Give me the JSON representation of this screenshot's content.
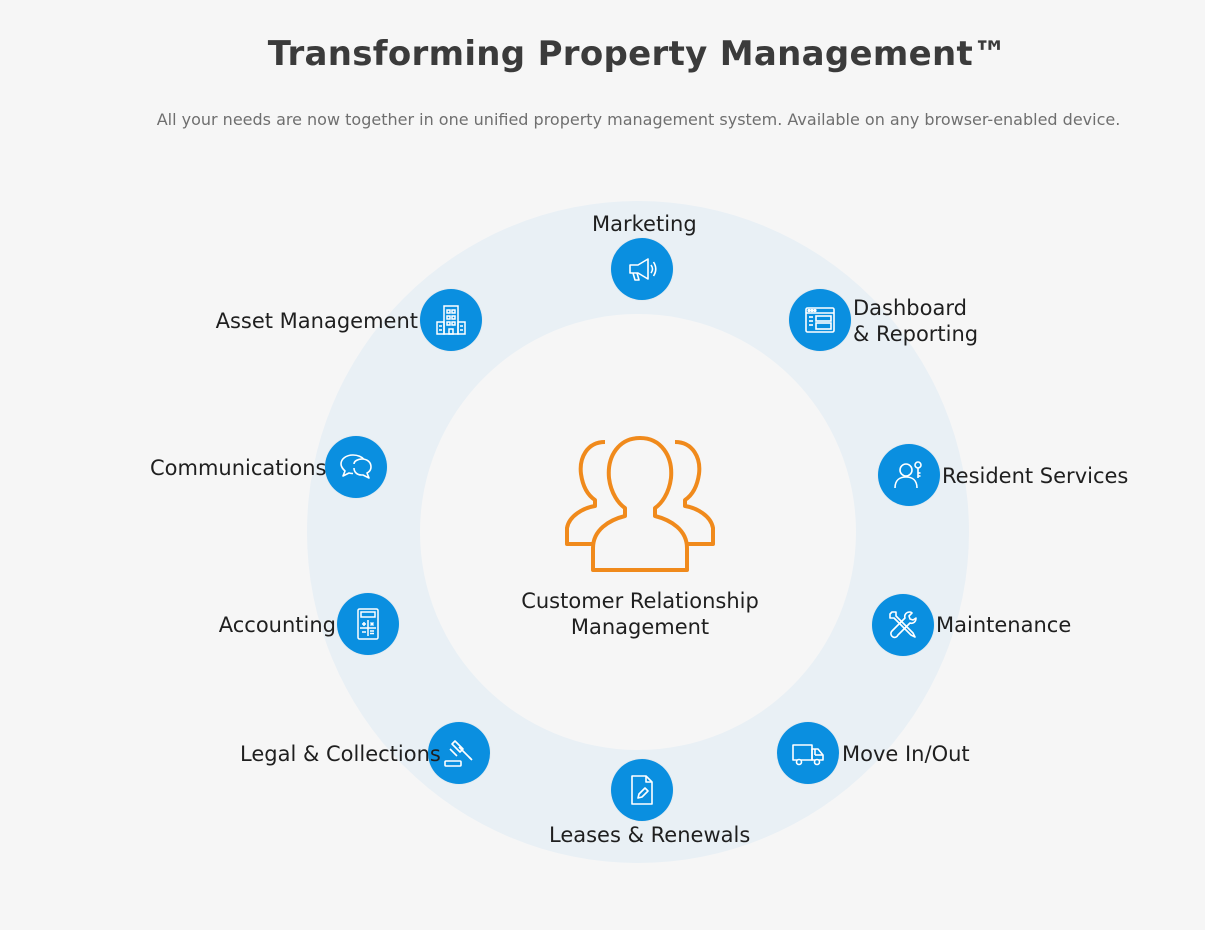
{
  "header": {
    "title": "Transforming Property Management™",
    "subtitle": "All your needs are now together in one unified property management system. Available on any browser-enabled device."
  },
  "center": {
    "label_line1": "Customer Relationship",
    "label_line2": "Management",
    "icon": "people-group-icon",
    "color": "#f08a1c"
  },
  "colors": {
    "module_blue": "#0a8fe0",
    "ring": "#e9f0f5",
    "background": "#f6f6f6"
  },
  "modules": {
    "marketing": {
      "label": "Marketing",
      "icon": "megaphone-icon"
    },
    "dashboard": {
      "label_line1": "Dashboard",
      "label_line2": "& Reporting",
      "icon": "dashboard-icon"
    },
    "resident": {
      "label": "Resident Services",
      "icon": "resident-key-icon"
    },
    "maintenance": {
      "label": "Maintenance",
      "icon": "tools-icon"
    },
    "move": {
      "label": "Move In/Out",
      "icon": "truck-icon"
    },
    "leases": {
      "label": "Leases & Renewals",
      "icon": "document-pen-icon"
    },
    "legal": {
      "label": "Legal & Collections",
      "icon": "gavel-icon"
    },
    "accounting": {
      "label": "Accounting",
      "icon": "calculator-icon"
    },
    "communications": {
      "label": "Communications",
      "icon": "chat-bubbles-icon"
    },
    "asset": {
      "label": "Asset Management",
      "icon": "building-icon"
    }
  }
}
